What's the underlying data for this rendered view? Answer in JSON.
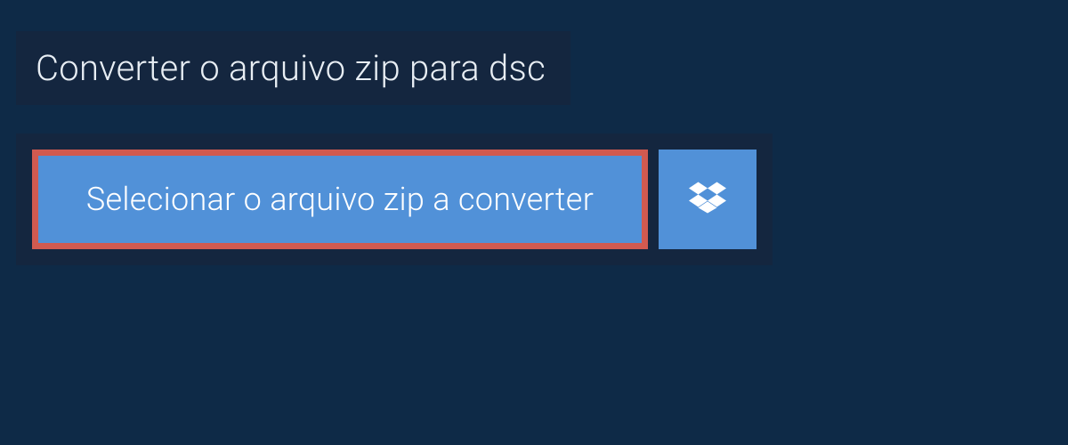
{
  "header": {
    "title": "Converter o arquivo zip para dsc"
  },
  "upload": {
    "select_file_label": "Selecionar o arquivo zip a converter"
  }
}
